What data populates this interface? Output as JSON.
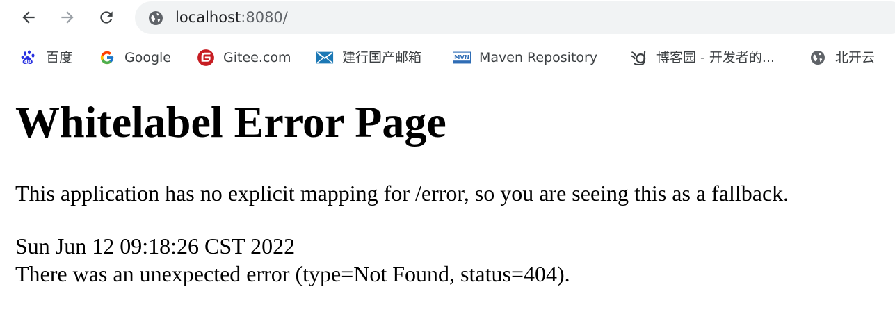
{
  "browser": {
    "nav": {
      "back_icon": "arrow-left-icon",
      "forward_icon": "arrow-right-icon",
      "reload_icon": "reload-icon"
    },
    "address_bar": {
      "host": "localhost",
      "rest": ":8080/",
      "icon": "globe-icon"
    },
    "bookmarks": [
      {
        "label": "百度",
        "icon": "baidu-paw-icon"
      },
      {
        "label": "Google",
        "icon": "google-g-icon"
      },
      {
        "label": "Gitee.com",
        "icon": "gitee-icon"
      },
      {
        "label": "建行国产邮箱",
        "icon": "mail-envelope-icon"
      },
      {
        "label": "Maven Repository",
        "icon": "mvn-icon"
      },
      {
        "label": "博客园 - 开发者的...",
        "icon": "cnblogs-icon"
      },
      {
        "label": "北开云",
        "icon": "globe-icon"
      }
    ]
  },
  "page": {
    "title": "Whitelabel Error Page",
    "message": "This application has no explicit mapping for /error, so you are seeing this as a fallback.",
    "timestamp": "Sun Jun 12 09:18:26 CST 2022",
    "error": "There was an unexpected error (type=Not Found, status=404)."
  },
  "colors": {
    "omnibox_bg": "#f1f3f4",
    "icon_gray": "#5f6368",
    "baidu_blue": "#2932e1",
    "gitee_red": "#c71d23",
    "mail_blue": "#1b78b5",
    "mvn_blue": "#2f6db5"
  }
}
